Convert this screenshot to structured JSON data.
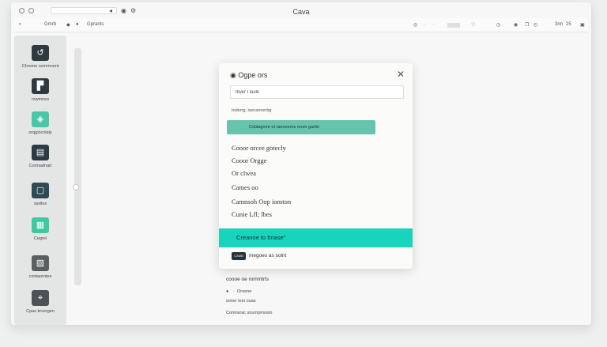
{
  "window": {
    "title": "Cava"
  },
  "toolbar": {
    "left_text": "Gmrb",
    "right_text": "Gprants",
    "right_status": "3nn",
    "right_num": "25",
    "right_num2": "2"
  },
  "sidebar": {
    "items": [
      {
        "label": "Chrome ozmmnent",
        "icon": "link-icon",
        "color": "#2f3a40"
      },
      {
        "label": "rswmnes",
        "icon": "image-icon",
        "color": "#2f3a40"
      },
      {
        "label": "orqgiocnlaly",
        "icon": "shape-icon",
        "color": "#49c7a8"
      },
      {
        "label": "Cormadnatr",
        "icon": "text-icon",
        "color": "#2b3a45"
      },
      {
        "label": "sartles",
        "icon": "frame-icon",
        "color": "#2d4a55"
      },
      {
        "label": "Cegrel",
        "icon": "grid-icon",
        "color": "#3fc9a3"
      },
      {
        "label": "contaorntes",
        "icon": "layout-icon",
        "color": "#5a5f60"
      },
      {
        "label": "Cpas tevergen",
        "icon": "scan-icon",
        "color": "#4d5355"
      }
    ]
  },
  "dialog": {
    "title": "Ogpe ors",
    "close_symbol": "✕",
    "input_value": "Itwer l laolk",
    "subtitle": "Inderrg, iwcrannerbg",
    "selected_label": "Coblagomr ot raeonerns reom gartte",
    "options": [
      "Cooor orcee gotecly",
      "Cooor Orgge",
      "Or clwea",
      "Cames oo",
      "Camnsoh Oop iomton",
      "Cunie Lfl; lbes"
    ],
    "banner_label": "Creanoe to fmase°",
    "chip_text": "CAMB",
    "chip_label": "megoes as solnt"
  },
  "below_dialog": {
    "heading": "coooe oe rommtrts",
    "item1": "Oroene",
    "item2": "soner lem ouas",
    "item3": "Comnsrac snurnpmosto"
  }
}
